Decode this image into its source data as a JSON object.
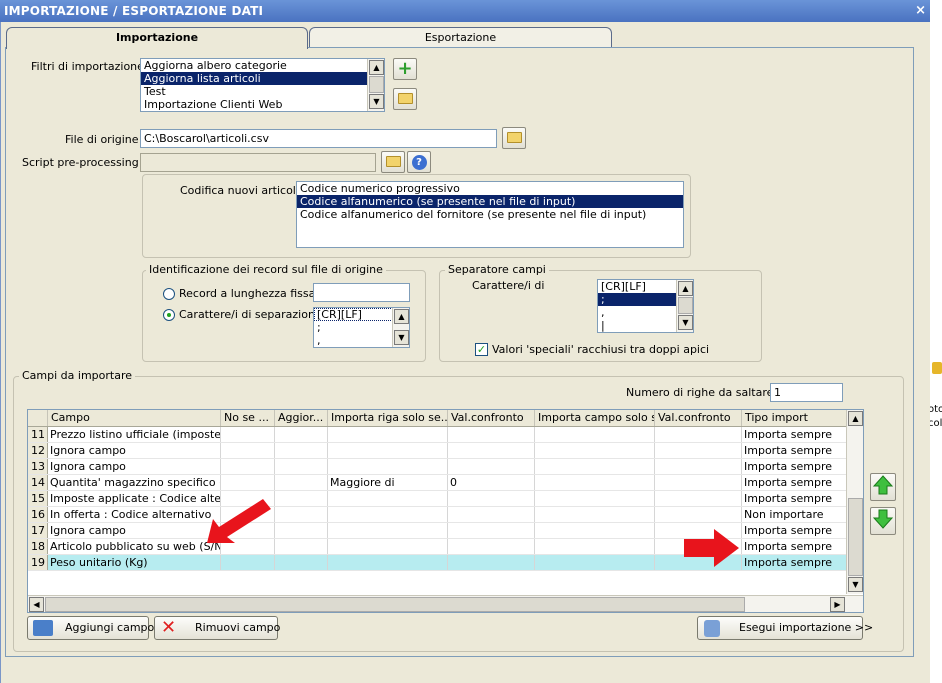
{
  "window": {
    "title": "IMPORTAZIONE / ESPORTAZIONE DATI",
    "close_glyph": "×"
  },
  "tabs": [
    {
      "label": "Importazione",
      "active": true
    },
    {
      "label": "Esportazione",
      "active": false
    }
  ],
  "filters": {
    "label": "Filtri di importazione :",
    "items": [
      "Aggiorna albero categorie",
      "Aggiorna lista articoli",
      "Test",
      "Importazione Clienti Web"
    ],
    "selected_index": 1
  },
  "origin_file": {
    "label": "File di origine :",
    "value": "C:\\Boscarol\\articoli.csv"
  },
  "script": {
    "label": "Script pre-processing :",
    "value": ""
  },
  "encoding": {
    "label": "Codifica nuovi articoli :",
    "items": [
      "Codice numerico progressivo",
      "Codice alfanumerico (se presente nel file di input)",
      "Codice alfanumerico del fornitore (se presente nel file di input)"
    ],
    "selected_index": 1
  },
  "record_id": {
    "title": "Identificazione dei record sul file di origine",
    "radio_fixed": "Record a lunghezza fissa",
    "radio_sep": "Carattere/i di separazione",
    "selected": "sep",
    "sep_items": [
      "[CR][LF]",
      ";",
      ","
    ]
  },
  "field_sep": {
    "title": "Separatore campi",
    "label": "Carattere/i di",
    "items": [
      "[CR][LF]",
      ";",
      ",",
      "|"
    ],
    "selected_index": 1,
    "quote_label": "Valori 'speciali' racchiusi tra doppi apici",
    "quote_checked": true
  },
  "fields": {
    "title": "Campi da importare",
    "skip_label": "Numero di righe da saltare :",
    "skip_value": "1",
    "columns": [
      "",
      "Campo",
      "No se ...",
      "Aggior...",
      "Importa riga solo se...",
      "Val.confronto",
      "Importa campo solo s...",
      "Val.confronto",
      "Tipo import"
    ],
    "rows": [
      {
        "n": "11",
        "campo": "Prezzo listino ufficiale (imposte e...",
        "c2": "",
        "c3": "",
        "c4": "",
        "c5": "",
        "c6": "",
        "c7": "",
        "tipo": "Importa sempre"
      },
      {
        "n": "12",
        "campo": "Ignora campo",
        "c2": "",
        "c3": "",
        "c4": "",
        "c5": "",
        "c6": "",
        "c7": "",
        "tipo": "Importa sempre"
      },
      {
        "n": "13",
        "campo": "Ignora campo",
        "c2": "",
        "c3": "",
        "c4": "",
        "c5": "",
        "c6": "",
        "c7": "",
        "tipo": "Importa sempre"
      },
      {
        "n": "14",
        "campo": "Quantita' magazzino specifico (V...",
        "c2": "",
        "c3": "",
        "c4": "Maggiore di",
        "c5": "0",
        "c6": "",
        "c7": "",
        "tipo": "Importa sempre"
      },
      {
        "n": "15",
        "campo": "Imposte applicate : Codice alter...",
        "c2": "",
        "c3": "",
        "c4": "",
        "c5": "",
        "c6": "",
        "c7": "",
        "tipo": "Importa sempre"
      },
      {
        "n": "16",
        "campo": "In offerta : Codice alternativo",
        "c2": "",
        "c3": "",
        "c4": "",
        "c5": "",
        "c6": "",
        "c7": "",
        "tipo": "Non importare"
      },
      {
        "n": "17",
        "campo": "Ignora campo",
        "c2": "",
        "c3": "",
        "c4": "",
        "c5": "",
        "c6": "",
        "c7": "",
        "tipo": "Importa sempre"
      },
      {
        "n": "18",
        "campo": "Articolo pubblicato su web (S/N)",
        "c2": "",
        "c3": "",
        "c4": "",
        "c5": "",
        "c6": "",
        "c7": "",
        "tipo": "Importa sempre"
      },
      {
        "n": "19",
        "campo": "Peso unitario (Kg)",
        "c2": "",
        "c3": "",
        "c4": "",
        "c5": "",
        "c6": "",
        "c7": "",
        "tipo": "Importa sempre"
      }
    ],
    "selected_row": 8
  },
  "buttons": {
    "add": "Aggiungi campo",
    "remove": "Rimuovi campo",
    "execute": "Esegui importazione >>"
  },
  "side_fragment": {
    "line1": "oto",
    "line2": "coli"
  },
  "colors": {
    "title_bar": "#4a72c0",
    "selection": "#0a246a",
    "row_highlight": "#b7ecf0",
    "annotation_arrow": "#e8141c"
  }
}
